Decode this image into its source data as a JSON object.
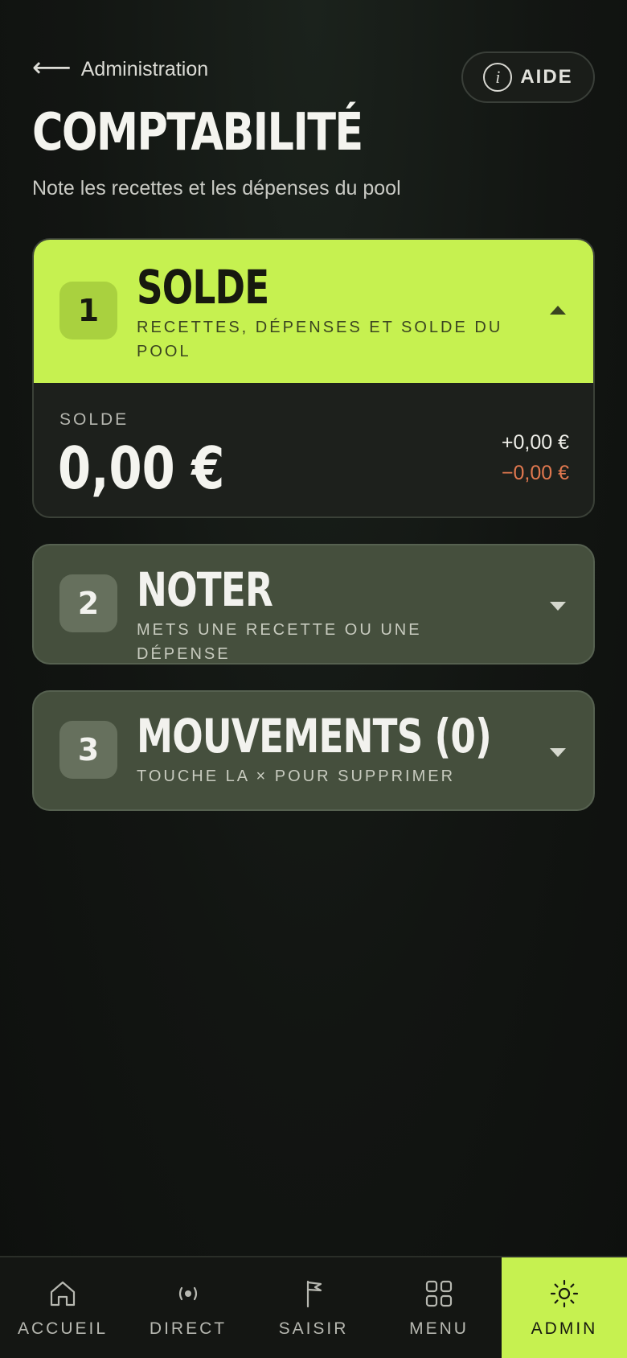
{
  "header": {
    "back_label": "Administration",
    "back_arrow": "⟵",
    "help_icon_glyph": "i",
    "help_label": "AIDE",
    "title": "COMPTABILITÉ",
    "subtitle": "Note les recettes et les dépenses du pool"
  },
  "cards": [
    {
      "step": "1",
      "title": "SOLDE",
      "subtitle": "RECETTES, DÉPENSES ET SOLDE DU POOL",
      "expanded": true,
      "balance": {
        "label": "SOLDE",
        "value": "0,00 €",
        "income": "+0,00 €",
        "expense": "−0,00 €"
      }
    },
    {
      "step": "2",
      "title": "NOTER",
      "subtitle": "METS UNE RECETTE OU UNE DÉPENSE",
      "expanded": false
    },
    {
      "step": "3",
      "title": "MOUVEMENTS (0)",
      "subtitle": "TOUCHE LA × POUR SUPPRIMER",
      "expanded": false
    }
  ],
  "nav": [
    {
      "label": "ACCUEIL",
      "icon": "home-icon",
      "active": false
    },
    {
      "label": "DIRECT",
      "icon": "broadcast-icon",
      "active": false
    },
    {
      "label": "SAISIR",
      "icon": "flag-icon",
      "active": false
    },
    {
      "label": "MENU",
      "icon": "grid-icon",
      "active": false
    },
    {
      "label": "ADMIN",
      "icon": "sun-icon",
      "active": true
    }
  ],
  "colors": {
    "accent": "#c6f150",
    "background": "#111411",
    "card_muted": "#454f3d",
    "expense": "#e0784f"
  }
}
